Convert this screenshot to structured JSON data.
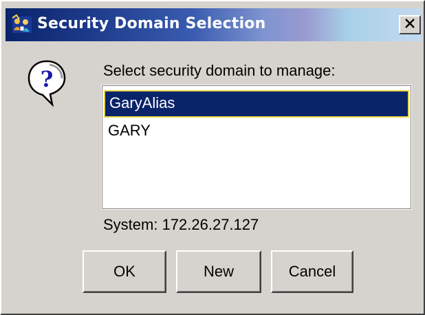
{
  "window": {
    "title": "Security Domain Selection",
    "close_glyph": "×",
    "icon": "users-security-icon"
  },
  "dialog": {
    "icon": "question-icon",
    "prompt": "Select security domain to manage:",
    "domains": [
      {
        "label": "GaryAlias",
        "selected": true
      },
      {
        "label": "GARY",
        "selected": false
      }
    ],
    "system_text": "System: 172.26.27.127"
  },
  "buttons": {
    "ok": "OK",
    "new": "New",
    "cancel": "Cancel"
  },
  "colors": {
    "title_bar_start": "#0a246a",
    "title_bar_end": "#c4daf0",
    "dialog_face": "#d6d3ce",
    "selection_bg": "#0a246a",
    "selection_border": "#e8d84a",
    "selection_text": "#ffffff"
  }
}
